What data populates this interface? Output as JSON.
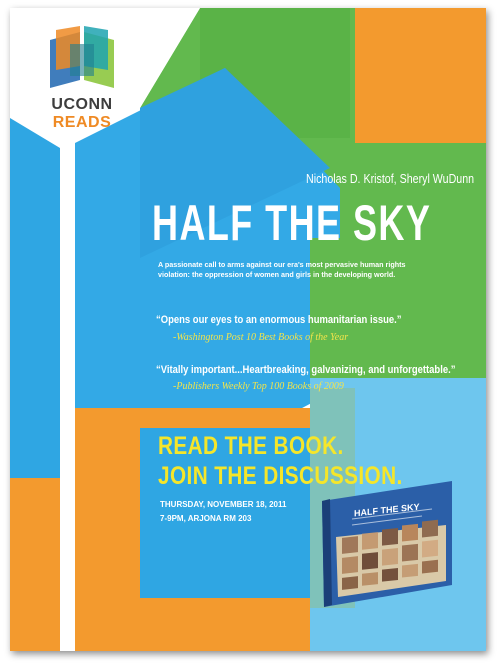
{
  "logo": {
    "line1": "UCONN",
    "line2": "READS",
    "icon": "open-book-icon",
    "colors": [
      "#2b6fb5",
      "#8dc63f",
      "#ef8a24",
      "#1fa3b0"
    ]
  },
  "book": {
    "authors": "Nicholas D. Kristof, Sheryl WuDunn",
    "title": "HALF THE SKY",
    "blurb": "A passionate call to arms against our era's most pervasive human rights violation: the oppression of women and girls in the developing world."
  },
  "quotes": [
    {
      "text": "“Opens our eyes to an enormous humanitarian issue.”",
      "source": "-Washington Post 10 Best Books of the Year"
    },
    {
      "text": "“Vitally important...Heartbreaking, galvanizing, and unforgettable.”",
      "source": "-Publishers Weekly Top 100 Books of 2009"
    }
  ],
  "cta": {
    "line1": "READ THE BOOK.",
    "line2": "JOIN THE DISCUSSION."
  },
  "event": {
    "date": "THURSDAY, NOVEMBER 18, 2011",
    "time_place": "7-9PM, ARJONA RM 203"
  },
  "cover": {
    "title": "HALF THE SKY"
  },
  "colors": {
    "sky_blue": "#3aa9e3",
    "green": "#6cbf4a",
    "orange": "#f4922a",
    "yellow_text": "#f5e62a",
    "pale_blue": "#6cc5ec"
  }
}
